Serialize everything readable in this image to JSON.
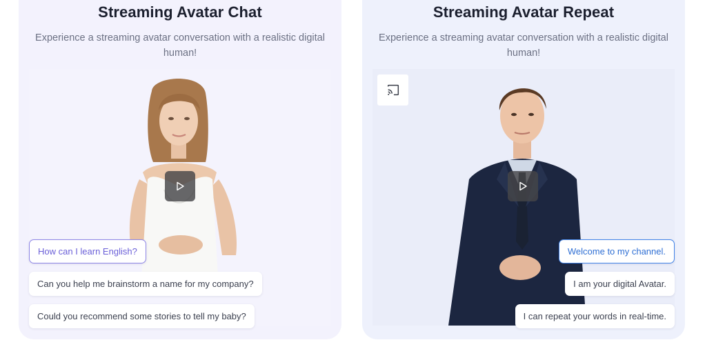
{
  "chat_card": {
    "title": "Streaming Avatar Chat",
    "subtitle": "Experience a streaming avatar conversation with a realistic digital human!",
    "suggestions": [
      "How can I learn English?",
      "Can you help me brainstorm a name for my company?",
      "Could you recommend some stories to tell my baby?"
    ]
  },
  "repeat_card": {
    "title": "Streaming Avatar Repeat",
    "subtitle": "Experience a streaming avatar conversation with a realistic digital human!",
    "phrases": [
      "Welcome to my channel.",
      "I am your digital Avatar.",
      "I can repeat your words in real-time."
    ]
  },
  "icons": {
    "play": "play-icon",
    "cast": "cast-icon"
  },
  "colors": {
    "chat_active_border": "#8d84e6",
    "repeat_active_border": "#3f82e8",
    "card_bg": "#f3f2fd"
  }
}
